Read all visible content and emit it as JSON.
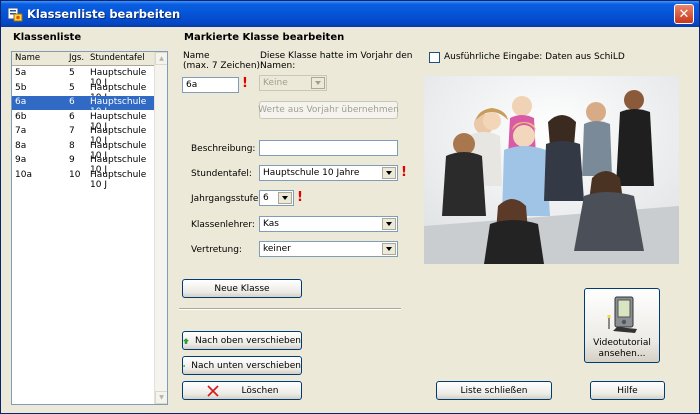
{
  "window": {
    "title": "Klassenliste bearbeiten"
  },
  "left": {
    "heading": "Klassenliste",
    "columns": [
      "Name",
      "Jgs.",
      "Stundentafel"
    ],
    "rows": [
      {
        "name": "5a",
        "jgs": "5",
        "tafel": "Hauptschule 10 J"
      },
      {
        "name": "5b",
        "jgs": "5",
        "tafel": "Hauptschule 10 J"
      },
      {
        "name": "6a",
        "jgs": "6",
        "tafel": "Hauptschule 10 J"
      },
      {
        "name": "6b",
        "jgs": "6",
        "tafel": "Hauptschule 10 J"
      },
      {
        "name": "7a",
        "jgs": "7",
        "tafel": "Hauptschule 10 J"
      },
      {
        "name": "8a",
        "jgs": "8",
        "tafel": "Hauptschule 10 J"
      },
      {
        "name": "9a",
        "jgs": "9",
        "tafel": "Hauptschule 10 J"
      },
      {
        "name": "10a",
        "jgs": "10",
        "tafel": "Hauptschule 10 J"
      }
    ],
    "selected_index": 2
  },
  "form": {
    "heading": "Markierte Klasse bearbeiten",
    "name_label_1": "Name",
    "name_label_2": "(max. 7 Zeichen):",
    "name_value": "6a",
    "vorjahr_label_1": "Diese Klasse hatte im Vorjahr den",
    "vorjahr_label_2": "Namen:",
    "vorjahr_value": "Keine",
    "vorjahr_button": "Werte aus Vorjahr übernehmen",
    "beschreibung_label": "Beschreibung:",
    "beschreibung_value": "",
    "stundentafel_label": "Stundentafel:",
    "stundentafel_value": "Hauptschule 10 Jahre",
    "jahrgang_label": "Jahrgangsstufe:",
    "jahrgang_value": "6",
    "klassenlehrer_label": "Klassenlehrer:",
    "klassenlehrer_value": "Kas",
    "vertretung_label": "Vertretung:",
    "vertretung_value": "keiner",
    "required_mark": "!"
  },
  "options": {
    "detail_checkbox_label": "Ausführliche Eingabe: Daten aus SchiLD",
    "detail_checked": false
  },
  "buttons": {
    "neue_klasse": "Neue Klasse",
    "nach_oben": "Nach oben verschieben",
    "nach_unten": "Nach unten verschieben",
    "loeschen": "Löschen",
    "liste_schliessen": "Liste schließen",
    "hilfe": "Hilfe",
    "video_1": "Videotutorial",
    "video_2": "ansehen..."
  },
  "colors": {
    "title_blue": "#0553d6",
    "selection": "#316ac5",
    "required": "#e00000",
    "arrow_green": "#2fa62f"
  },
  "icons": [
    "app-icon",
    "close-icon",
    "arrow-up-icon",
    "arrow-down-icon",
    "delete-x-icon",
    "pda-device-icon"
  ]
}
